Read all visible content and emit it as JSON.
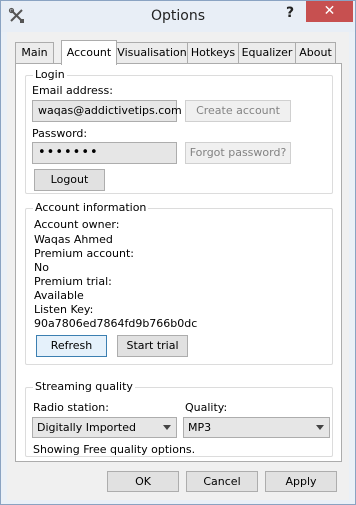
{
  "window": {
    "title": "Options",
    "help_glyph": "?",
    "close_glyph": "✕"
  },
  "tabs": [
    {
      "label": "Main"
    },
    {
      "label": "Account"
    },
    {
      "label": "Visualisation"
    },
    {
      "label": "Hotkeys"
    },
    {
      "label": "Equalizer"
    },
    {
      "label": "About"
    }
  ],
  "login": {
    "legend": "Login",
    "email_label": "Email address:",
    "email_value": "waqas@addictivetips.com",
    "create_account_label": "Create account",
    "password_label": "Password:",
    "password_value": "•••••••",
    "forgot_password_label": "Forgot password?",
    "logout_label": "Logout"
  },
  "account_info": {
    "legend": "Account information",
    "owner_label": "Account owner:",
    "owner_value": "Waqas Ahmed",
    "premium_label": "Premium account:",
    "premium_value": "No",
    "trial_label": "Premium trial:",
    "trial_value": "Available",
    "key_label": "Listen Key:",
    "key_value": "90a7806ed7864fd9b766b0dc",
    "refresh_label": "Refresh",
    "start_trial_label": "Start trial"
  },
  "streaming": {
    "legend": "Streaming quality",
    "station_label": "Radio station:",
    "station_value": "Digitally Imported",
    "quality_label": "Quality:",
    "quality_value": "MP3",
    "note": "Showing Free quality options."
  },
  "footer": {
    "ok_label": "OK",
    "cancel_label": "Cancel",
    "apply_label": "Apply"
  },
  "icons": {
    "app": "tools-icon",
    "help": "help-icon",
    "close": "close-icon",
    "dropdown": "chevron-down-icon"
  }
}
